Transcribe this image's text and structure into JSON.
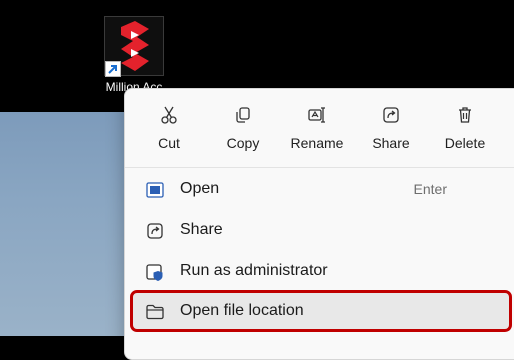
{
  "desktop": {
    "shortcut_label": "Million Acc"
  },
  "context_menu": {
    "actions": [
      {
        "label": "Cut",
        "icon": "scissors-icon"
      },
      {
        "label": "Copy",
        "icon": "copy-icon"
      },
      {
        "label": "Rename",
        "icon": "rename-icon"
      },
      {
        "label": "Share",
        "icon": "share-icon"
      },
      {
        "label": "Delete",
        "icon": "trash-icon"
      }
    ],
    "items": [
      {
        "label": "Open",
        "shortcut": "Enter",
        "icon": "open-app-icon"
      },
      {
        "label": "Share",
        "icon": "share-icon"
      },
      {
        "label": "Run as administrator",
        "icon": "admin-shield-icon"
      },
      {
        "label": "Open file location",
        "icon": "folder-icon"
      }
    ]
  },
  "colors": {
    "accent": "#2b5fb4",
    "highlight_border": "#c00000",
    "logo_red": "#e4222c"
  }
}
